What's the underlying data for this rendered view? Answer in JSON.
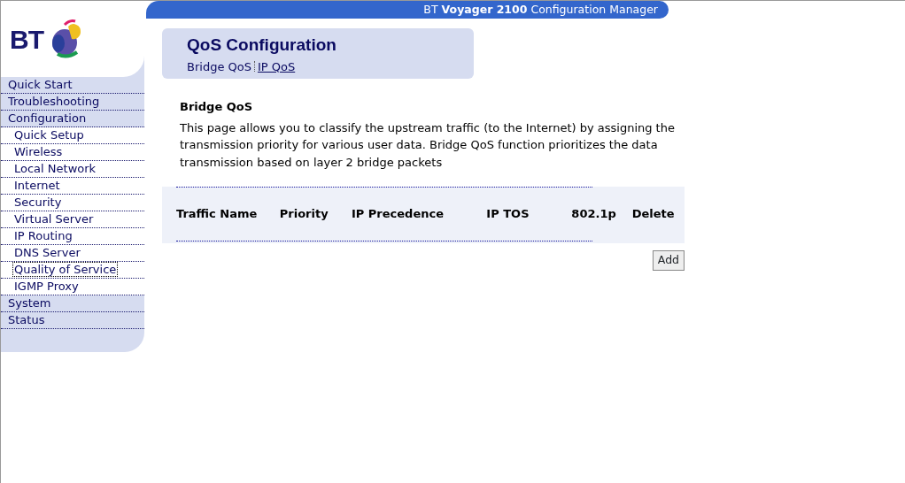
{
  "header": {
    "brand": "BT",
    "product": "Voyager 2100",
    "suffix": "Configuration Manager"
  },
  "logo": {
    "text": "BT"
  },
  "sidebar": {
    "items": [
      {
        "label": "Quick Start",
        "kind": "section",
        "selected": false
      },
      {
        "label": "Troubleshooting",
        "kind": "section",
        "selected": false
      },
      {
        "label": "Configuration",
        "kind": "section",
        "selected": false
      },
      {
        "label": "Quick Setup",
        "kind": "sub",
        "selected": false
      },
      {
        "label": "Wireless",
        "kind": "sub",
        "selected": false
      },
      {
        "label": "Local Network",
        "kind": "sub",
        "selected": false
      },
      {
        "label": "Internet",
        "kind": "sub",
        "selected": false
      },
      {
        "label": "Security",
        "kind": "sub",
        "selected": false
      },
      {
        "label": "Virtual Server",
        "kind": "sub",
        "selected": false
      },
      {
        "label": "IP Routing",
        "kind": "sub",
        "selected": false
      },
      {
        "label": "DNS Server",
        "kind": "sub",
        "selected": false
      },
      {
        "label": "Quality of Service",
        "kind": "sub",
        "selected": true
      },
      {
        "label": "IGMP Proxy",
        "kind": "sub",
        "selected": false
      },
      {
        "label": "System",
        "kind": "section",
        "selected": false
      },
      {
        "label": "Status",
        "kind": "section",
        "selected": false
      }
    ]
  },
  "title_panel": {
    "title": "QoS Configuration",
    "tabs": [
      {
        "label": "Bridge QoS",
        "selected": true
      },
      {
        "label": "IP QoS",
        "selected": false
      }
    ]
  },
  "section": {
    "heading": "Bridge QoS",
    "description": "This page allows you to classify the upstream traffic (to the Internet) by assigning the transmission priority for various user data. Bridge QoS function prioritizes the data transmission based on layer 2 bridge packets"
  },
  "table": {
    "columns": [
      "Traffic Name",
      "Priority",
      "IP Precedence",
      "IP TOS",
      "802.1p",
      "Delete"
    ]
  },
  "buttons": [
    "Add"
  ]
}
